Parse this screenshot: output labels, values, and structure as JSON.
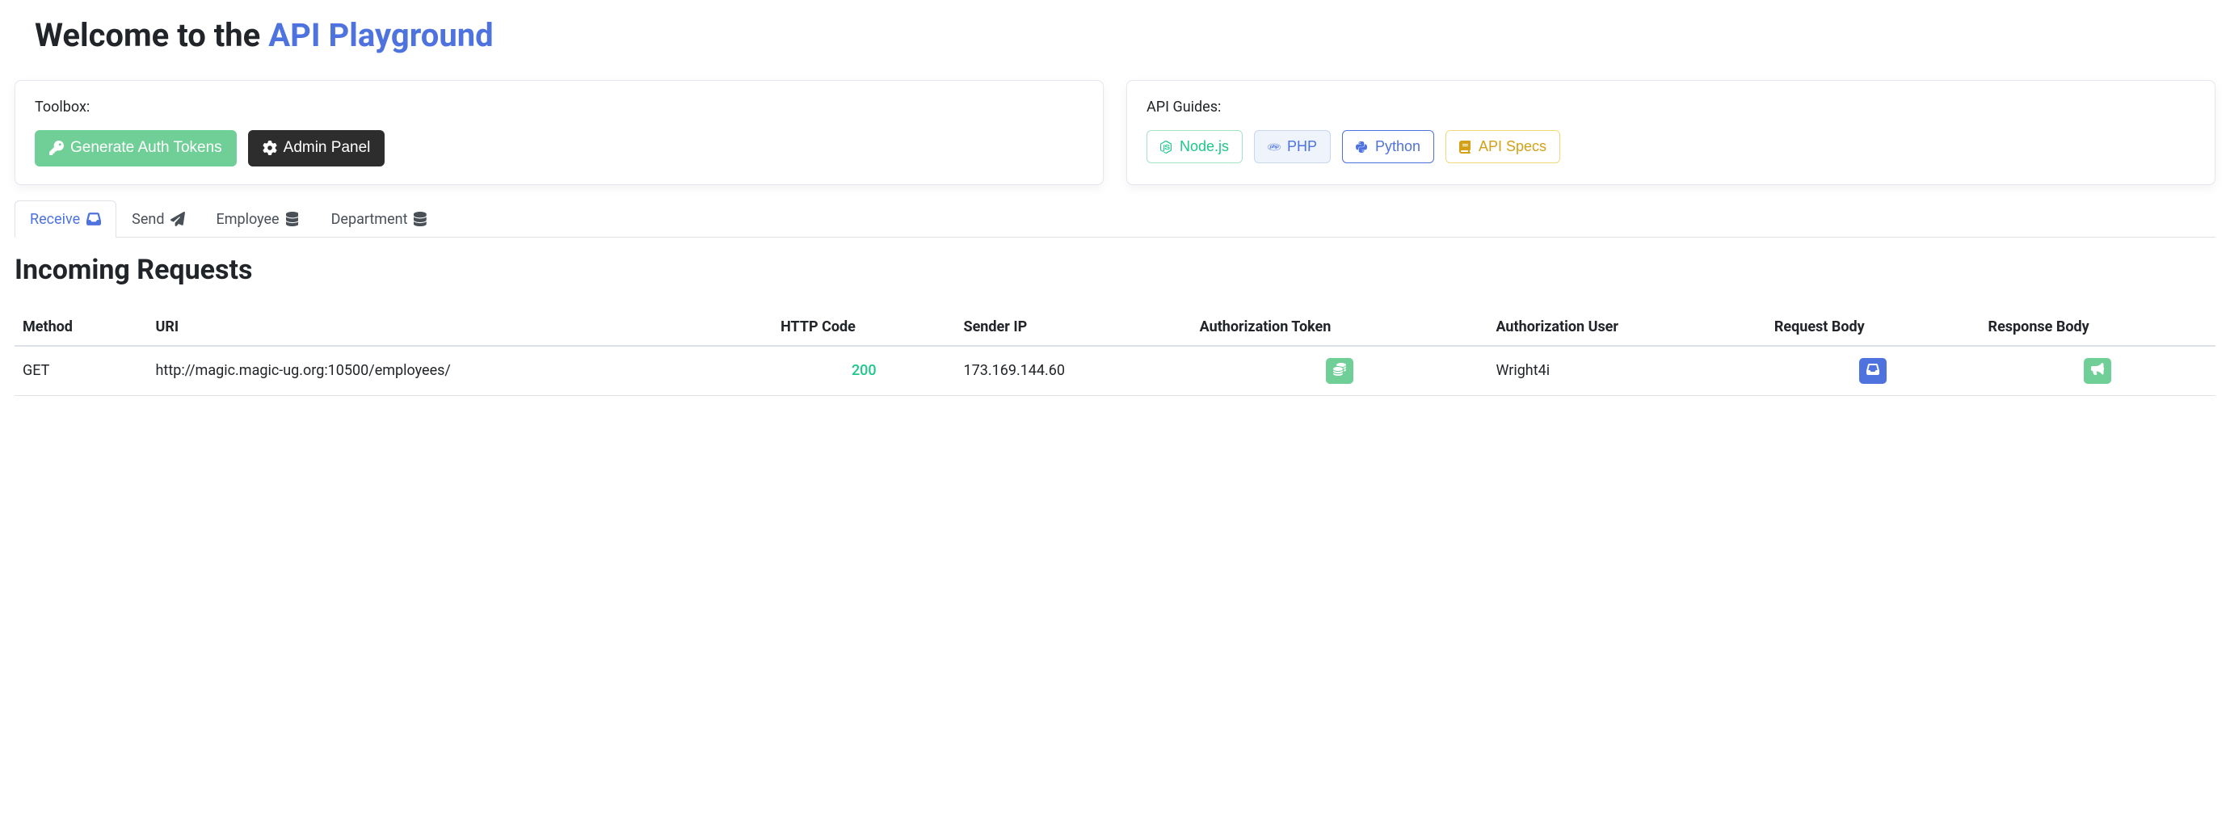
{
  "header": {
    "title_prefix": "Welcome to the ",
    "title_highlight": "API Playground"
  },
  "toolbox": {
    "label": "Toolbox:",
    "generate_tokens": "Generate Auth Tokens",
    "admin_panel": "Admin Panel"
  },
  "guides": {
    "label": "API Guides:",
    "nodejs": "Node.js",
    "php": "PHP",
    "python": "Python",
    "api_specs": "API Specs"
  },
  "tabs": {
    "receive": "Receive",
    "send": "Send",
    "employee": "Employee",
    "department": "Department"
  },
  "section": {
    "incoming_requests": "Incoming Requests"
  },
  "table": {
    "headers": {
      "method": "Method",
      "uri": "URI",
      "http_code": "HTTP Code",
      "sender_ip": "Sender IP",
      "auth_token": "Authorization Token",
      "auth_user": "Authorization User",
      "request_body": "Request Body",
      "response_body": "Response Body"
    },
    "rows": [
      {
        "method": "GET",
        "uri": "http://magic.magic-ug.org:10500/employees/",
        "http_code": "200",
        "sender_ip": "173.169.144.60",
        "auth_user": "Wright4i"
      }
    ]
  }
}
